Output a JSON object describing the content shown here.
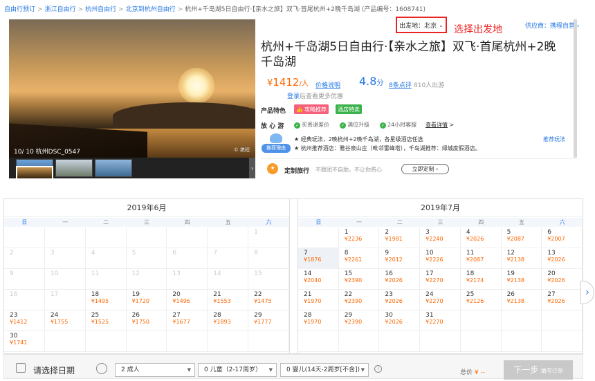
{
  "breadcrumb": {
    "items": [
      "自由行预订",
      "浙江自由行",
      "杭州自由行",
      "北京到杭州自由行"
    ],
    "current": "杭州+千岛湖5日自由行·【亲水之旅】双飞·首尾杭州+2晚千岛湖 (产品编号：1608741)"
  },
  "gallery": {
    "caption": "10/ 10  杭州DSC_0547",
    "watermark": "© 携程"
  },
  "departure": {
    "label": "出发地：北京",
    "annotation": "选择出发地"
  },
  "supplier": "供应商：携程自营",
  "product": {
    "title": "杭州+千岛湖5日自由行·【亲水之旅】双飞·首尾杭州+2晚千岛湖",
    "price_symbol": "¥",
    "price": "1412",
    "price_unit": "/人",
    "price_note": "价格说明",
    "score": "4.8",
    "score_unit": "分",
    "reviews": "8条点评",
    "travelers": "810人出游",
    "login_link": "登录",
    "login_text": "后查看更多优惠"
  },
  "features": {
    "label": "产品特色",
    "tag1": "攻略推荐",
    "tag2": "酒店特卖"
  },
  "worry_free": {
    "label": "放 心 游",
    "items": [
      "买贵退差价",
      "满位升级",
      "24小时客服"
    ],
    "detail": "查看详情",
    "detail_arrow": ">"
  },
  "recommend": {
    "badge": "推荐理由",
    "line1": "★ 经典玩法，2晚杭州+2晚千岛湖，各星级酒店任选",
    "line2": "★ 杭州推荐酒店：雅谷泉山庄（毗邻雷峰塔），千岛湖推荐：绿城度假酒店。",
    "more": "推荐玩法"
  },
  "custom": {
    "icon": "✦",
    "title": "定制旅行",
    "subtitle": "不跟团不自助，不让你费心",
    "button": "立即定制 ›"
  },
  "calendar": {
    "weekdays": [
      "日",
      "一",
      "二",
      "三",
      "四",
      "五",
      "六"
    ],
    "months": [
      {
        "title": "2019年6月",
        "cells": [
          {
            "d": "",
            "p": ""
          },
          {
            "d": "",
            "p": ""
          },
          {
            "d": "",
            "p": ""
          },
          {
            "d": "",
            "p": ""
          },
          {
            "d": "",
            "p": ""
          },
          {
            "d": "",
            "p": ""
          },
          {
            "d": "1",
            "p": "",
            "dim": true
          },
          {
            "d": "2",
            "p": "",
            "dim": true
          },
          {
            "d": "3",
            "p": "",
            "dim": true
          },
          {
            "d": "4",
            "p": "",
            "dim": true
          },
          {
            "d": "5",
            "p": "",
            "dim": true
          },
          {
            "d": "6",
            "p": "",
            "dim": true
          },
          {
            "d": "7",
            "p": "",
            "dim": true
          },
          {
            "d": "8",
            "p": "",
            "dim": true
          },
          {
            "d": "9",
            "p": "",
            "dim": true
          },
          {
            "d": "10",
            "p": "",
            "dim": true
          },
          {
            "d": "11",
            "p": "",
            "dim": true
          },
          {
            "d": "12",
            "p": "",
            "dim": true
          },
          {
            "d": "13",
            "p": "",
            "dim": true
          },
          {
            "d": "14",
            "p": "",
            "dim": true
          },
          {
            "d": "15",
            "p": "",
            "dim": true
          },
          {
            "d": "16",
            "p": "",
            "dim": true
          },
          {
            "d": "17",
            "p": "",
            "dim": true
          },
          {
            "d": "18",
            "p": "¥1495"
          },
          {
            "d": "19",
            "p": "¥1720"
          },
          {
            "d": "20",
            "p": "¥1496"
          },
          {
            "d": "21",
            "p": "¥1553"
          },
          {
            "d": "22",
            "p": "¥1475"
          },
          {
            "d": "23",
            "p": "¥1412"
          },
          {
            "d": "24",
            "p": "¥1755"
          },
          {
            "d": "25",
            "p": "¥1525"
          },
          {
            "d": "26",
            "p": "¥1750"
          },
          {
            "d": "27",
            "p": "¥1677"
          },
          {
            "d": "28",
            "p": "¥1893"
          },
          {
            "d": "29",
            "p": "¥1777"
          },
          {
            "d": "30",
            "p": "¥1741"
          },
          {
            "d": "",
            "p": ""
          },
          {
            "d": "",
            "p": ""
          },
          {
            "d": "",
            "p": ""
          },
          {
            "d": "",
            "p": ""
          },
          {
            "d": "",
            "p": ""
          },
          {
            "d": "",
            "p": ""
          }
        ]
      },
      {
        "title": "2019年7月",
        "cells": [
          {
            "d": "",
            "p": ""
          },
          {
            "d": "1",
            "p": "¥2236"
          },
          {
            "d": "2",
            "p": "¥1981"
          },
          {
            "d": "3",
            "p": "¥2240"
          },
          {
            "d": "4",
            "p": "¥2026"
          },
          {
            "d": "5",
            "p": "¥2087"
          },
          {
            "d": "6",
            "p": "¥2007"
          },
          {
            "d": "7",
            "p": "¥1876",
            "today": true
          },
          {
            "d": "8",
            "p": "¥2261"
          },
          {
            "d": "9",
            "p": "¥2012"
          },
          {
            "d": "10",
            "p": "¥2226"
          },
          {
            "d": "11",
            "p": "¥2087"
          },
          {
            "d": "12",
            "p": "¥2138"
          },
          {
            "d": "13",
            "p": "¥2026"
          },
          {
            "d": "14",
            "p": "¥2040"
          },
          {
            "d": "15",
            "p": "¥2390"
          },
          {
            "d": "16",
            "p": "¥2026"
          },
          {
            "d": "17",
            "p": "¥2270"
          },
          {
            "d": "18",
            "p": "¥2174"
          },
          {
            "d": "19",
            "p": "¥2138"
          },
          {
            "d": "20",
            "p": "¥2026"
          },
          {
            "d": "21",
            "p": "¥1970"
          },
          {
            "d": "22",
            "p": "¥2390"
          },
          {
            "d": "23",
            "p": "¥2026"
          },
          {
            "d": "24",
            "p": "¥2270"
          },
          {
            "d": "25",
            "p": "¥2126"
          },
          {
            "d": "26",
            "p": "¥2138"
          },
          {
            "d": "27",
            "p": "¥2026"
          },
          {
            "d": "28",
            "p": "¥1970"
          },
          {
            "d": "29",
            "p": "¥2390"
          },
          {
            "d": "30",
            "p": "¥2026"
          },
          {
            "d": "31",
            "p": "¥2270"
          },
          {
            "d": "",
            "p": ""
          },
          {
            "d": "",
            "p": ""
          },
          {
            "d": "",
            "p": ""
          },
          {
            "d": "",
            "p": ""
          },
          {
            "d": "",
            "p": ""
          },
          {
            "d": "",
            "p": ""
          },
          {
            "d": "",
            "p": ""
          },
          {
            "d": "",
            "p": ""
          },
          {
            "d": "",
            "p": ""
          },
          {
            "d": "",
            "p": ""
          }
        ]
      }
    ]
  },
  "booking": {
    "date_placeholder": "请选择日期",
    "adults": "2  成人",
    "children": "0  儿童（2-17周岁）",
    "infants": "0  婴儿(14天-2周岁[不含])",
    "total_label": "总价",
    "total_value": "¥ --",
    "next_label": "下一步",
    "next_sub": "填写订单"
  },
  "colors": {
    "link": "#2577e3",
    "price": "#ff6600",
    "annotation": "#ee2222"
  }
}
